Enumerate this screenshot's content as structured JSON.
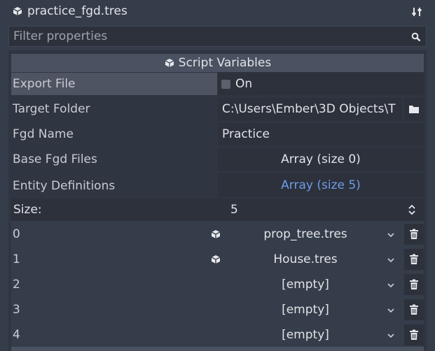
{
  "header": {
    "resource_name": "practice_fgd.tres",
    "resource_icon": "cube-icon",
    "tools_icon": "tools-icon"
  },
  "filter": {
    "placeholder": "Filter properties",
    "icon": "search-icon"
  },
  "section": {
    "title": "Script Variables",
    "icon": "cube-icon"
  },
  "properties": {
    "export_file": {
      "label": "Export File",
      "value": "On",
      "checked": false
    },
    "target_folder": {
      "label": "Target Folder",
      "value": "C:\\Users\\Ember\\3D Objects\\T",
      "icon": "folder-icon"
    },
    "fgd_name": {
      "label": "Fgd Name",
      "value": "Practice"
    },
    "base_fgd_files": {
      "label": "Base Fgd Files",
      "value": "Array (size 0)"
    },
    "entity_definitions": {
      "label": "Entity Definitions",
      "value": "Array (size 5)",
      "size_label": "Size:",
      "size_value": "5",
      "items": [
        {
          "index": "0",
          "value": "prop_tree.tres",
          "has_icon": true
        },
        {
          "index": "1",
          "value": "House.tres",
          "has_icon": true
        },
        {
          "index": "2",
          "value": "[empty]",
          "has_icon": false
        },
        {
          "index": "3",
          "value": "[empty]",
          "has_icon": false
        },
        {
          "index": "4",
          "value": "[empty]",
          "has_icon": false
        }
      ]
    }
  },
  "colors": {
    "background": "#363d4a",
    "field": "#2c313b",
    "section_header": "#4a5161",
    "highlight_row": "#4e5462",
    "link_blue": "#6f9ce6",
    "text": "#d6d9de",
    "placeholder": "#9ea4ad"
  }
}
